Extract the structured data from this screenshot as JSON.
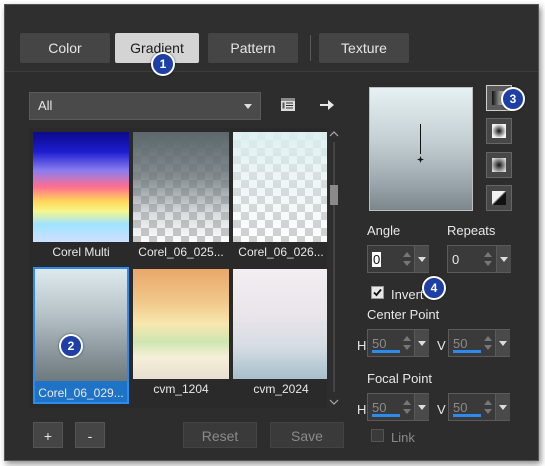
{
  "tabs": [
    {
      "label": "Color",
      "active": false
    },
    {
      "label": "Gradient",
      "active": true
    },
    {
      "label": "Pattern",
      "active": false
    },
    {
      "label": "Texture",
      "active": false
    }
  ],
  "markers": [
    "1",
    "2",
    "3",
    "4"
  ],
  "filter": {
    "selected": "All"
  },
  "gradients": [
    {
      "label": "Corel Multi",
      "selected": false
    },
    {
      "label": "Corel_06_025...",
      "selected": false
    },
    {
      "label": "Corel_06_026...",
      "selected": false
    },
    {
      "label": "Corel_06_029...",
      "selected": true
    },
    {
      "label": "cvm_1204",
      "selected": false
    },
    {
      "label": "cvm_2024",
      "selected": false
    }
  ],
  "buttons": {
    "add": "+",
    "remove": "-",
    "reset": "Reset",
    "save": "Save"
  },
  "angle": {
    "label": "Angle",
    "value": "0"
  },
  "repeats": {
    "label": "Repeats",
    "value": "0"
  },
  "invert": {
    "label": "Invert",
    "checked": true
  },
  "center_point": {
    "label": "Center Point",
    "h_label": "H",
    "h_value": "50",
    "v_label": "V",
    "v_value": "50"
  },
  "focal_point": {
    "label": "Focal Point",
    "h_label": "H",
    "h_value": "50",
    "v_label": "V",
    "v_value": "50"
  },
  "link": {
    "label": "Link",
    "checked": false
  },
  "colors": {
    "accent": "#2d8bf0",
    "panel": "#2d2d2d",
    "marker": "#1d3fa6"
  }
}
